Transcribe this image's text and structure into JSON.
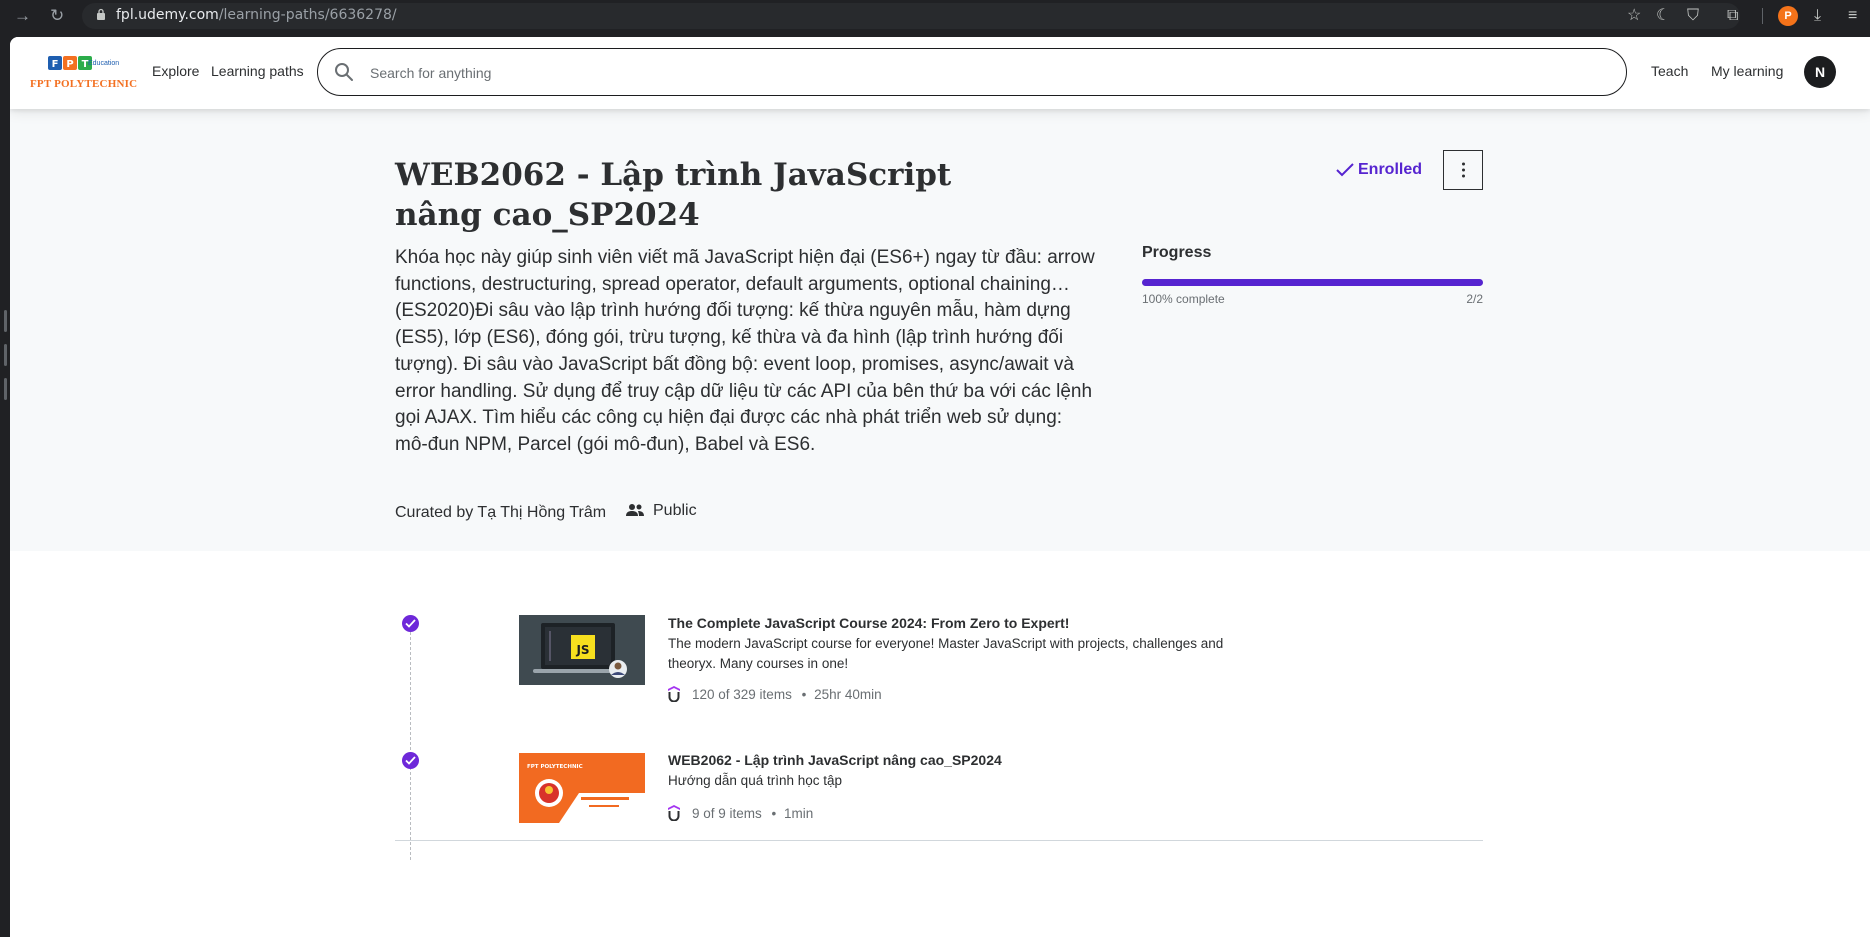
{
  "browser": {
    "url_domain": "fpl.udemy.com",
    "url_path": "/learning-paths/6636278/",
    "profile_initial": "P"
  },
  "header": {
    "logo_brand": "FPT POLYTECHNIC",
    "logo_sub": "Education",
    "explore": "Explore",
    "learning_paths": "Learning paths",
    "search_placeholder": "Search for anything",
    "teach": "Teach",
    "my_learning": "My learning",
    "avatar_initial": "N"
  },
  "hero": {
    "title": "WEB2062 - Lập trình JavaScript nâng cao_SP2024",
    "description": "Khóa học này giúp sinh viên viết mã JavaScript hiện đại (ES6+) ngay từ đầu: arrow functions, destructuring, spread operator, default arguments, optional chaining… (ES2020)Đi sâu vào lập trình hướng đối tượng: kế thừa nguyên mẫu, hàm dựng (ES5), lớp (ES6), đóng gói, trừu tượng, kế thừa và đa hình (lập trình hướng đối tượng). Đi sâu vào JavaScript bất đồng bộ: event loop, promises, async/await và error handling. Sử dụng để truy cập dữ liệu từ các API của bên thứ ba với các lệnh gọi AJAX. Tìm hiểu các công cụ hiện đại được các nhà phát triển web sử dụng: mô-đun NPM, Parcel (gói mô-đun), Babel và ES6.",
    "curated_by": "Curated by Tạ Thị Hồng Trâm",
    "visibility": "Public",
    "enrolled_label": "Enrolled",
    "progress": {
      "label": "Progress",
      "percent": 100,
      "percent_text": "100% complete",
      "count_text": "2/2"
    }
  },
  "courses": [
    {
      "title": "The Complete JavaScript Course 2024: From Zero to Expert!",
      "description": "The modern JavaScript course for everyone! Master JavaScript with projects, challenges and theoryx. Many courses in one!",
      "items": "120 of 329 items",
      "duration": "25hr 40min",
      "thumb_text": "JS",
      "completed": true
    },
    {
      "title": "WEB2062 - Lập trình JavaScript nâng cao_SP2024",
      "description": "Hướng dẫn quá trình học tập",
      "items": "9 of 9 items",
      "duration": "1min",
      "thumb_text": "FPT POLYTECHNIC",
      "completed": true
    }
  ],
  "colors": {
    "accent": "#5624d0",
    "check": "#6e28d9",
    "brand_orange": "#f37021"
  },
  "meta_separator": "•"
}
